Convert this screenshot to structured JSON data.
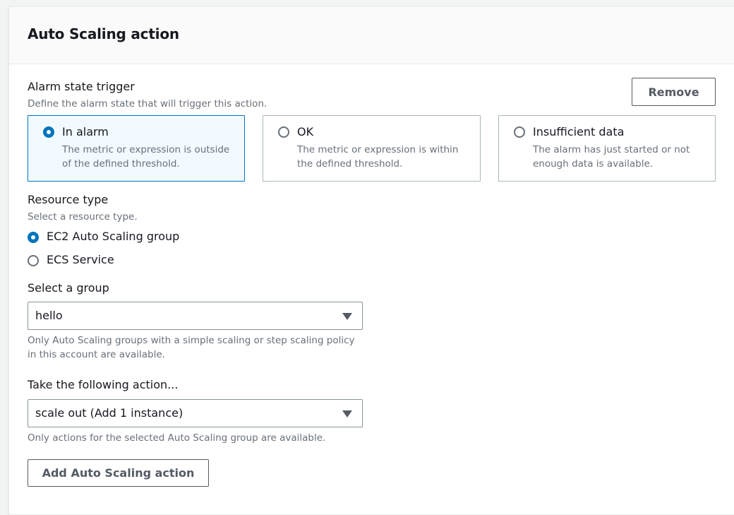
{
  "panel": {
    "title": "Auto Scaling action"
  },
  "alarm_trigger": {
    "label": "Alarm state trigger",
    "description": "Define the alarm state that will trigger this action.",
    "remove_label": "Remove",
    "options": [
      {
        "title": "In alarm",
        "description": "The metric or expression is outside of the defined threshold.",
        "selected": true
      },
      {
        "title": "OK",
        "description": "The metric or expression is within the defined threshold.",
        "selected": false
      },
      {
        "title": "Insufficient data",
        "description": "The alarm has just started or not enough data is available.",
        "selected": false
      }
    ]
  },
  "resource_type": {
    "label": "Resource type",
    "description": "Select a resource type.",
    "options": [
      {
        "label": "EC2 Auto Scaling group",
        "selected": true
      },
      {
        "label": "ECS Service",
        "selected": false
      }
    ]
  },
  "group": {
    "label": "Select a group",
    "value": "hello",
    "hint": "Only Auto Scaling groups with a simple scaling or step scaling policy in this account are available."
  },
  "action": {
    "label": "Take the following action...",
    "value": "scale out (Add 1 instance)",
    "hint": "Only actions for the selected Auto Scaling group are available."
  },
  "add_button_label": "Add Auto Scaling action",
  "colors": {
    "accent": "#0073bb",
    "selected_tile_bg": "#f1faff",
    "text_secondary": "#687078"
  }
}
